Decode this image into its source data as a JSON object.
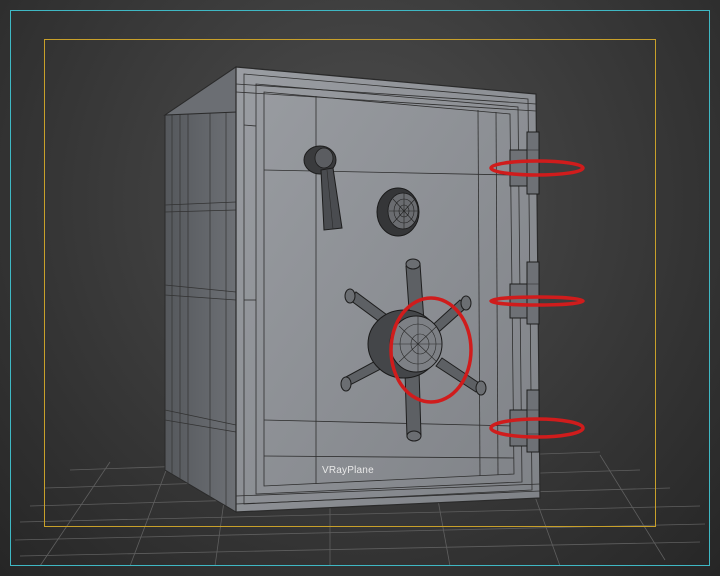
{
  "viewport": {
    "object_label": "VRayPlane"
  },
  "colors": {
    "viewport_border": "#3fb8c4",
    "safe_frame": "#c8a02a",
    "selection_ring": "#d01c1c",
    "mesh_fill": "#8a8d92",
    "wire": "#2c2c2c"
  },
  "scene": {
    "object": "safe",
    "ground": "vray-plane-grid",
    "highlighted_parts": [
      "hinge-ring-top",
      "hinge-ring-middle",
      "hinge-ring-bottom",
      "hub-ring"
    ]
  }
}
